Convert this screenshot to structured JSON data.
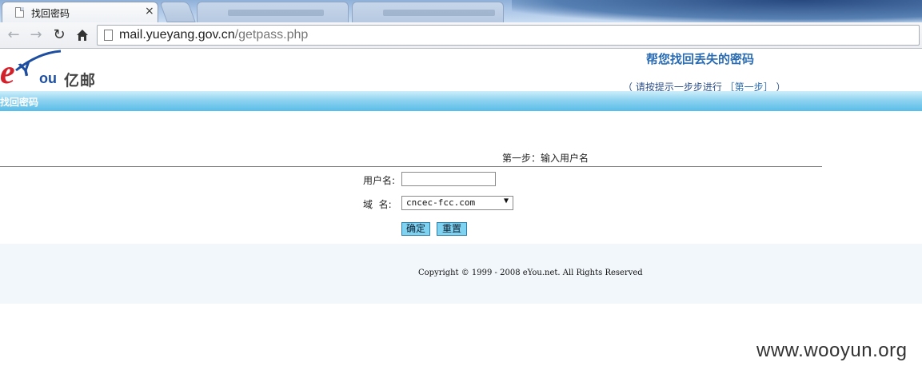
{
  "browser": {
    "active_tab_title": "找回密码",
    "tab_close_glyph": "×",
    "url_host": "mail.yueyang.gov.cn",
    "url_path": "/getpass.php"
  },
  "header": {
    "logo_text_cn": "亿邮",
    "title": "帮您找回丢失的密码",
    "step_prefix": "（  请按提示一步步进行   ",
    "step_link": "［第一步］",
    "step_suffix": "  ）"
  },
  "section_bar": {
    "label": "找回密码"
  },
  "form": {
    "step_heading": "第一步：输入用户名",
    "username_label": "用户名:",
    "username_value": "",
    "domain_label": "域  名:",
    "domain_selected": "cncec-fcc.com",
    "confirm_label": "确定",
    "reset_label": "重置"
  },
  "footer": {
    "copyright": "Copyright © 1999 - 2008 eYou.net. All Rights Reserved"
  },
  "watermark": {
    "text": "www.wooyun.org"
  },
  "colors": {
    "accent_blue": "#2a6cb3",
    "bar_blue": "#59bde8",
    "logo_red": "#d3212b",
    "logo_blue": "#1d4ea0",
    "footer_bg": "#f2f7fb"
  }
}
